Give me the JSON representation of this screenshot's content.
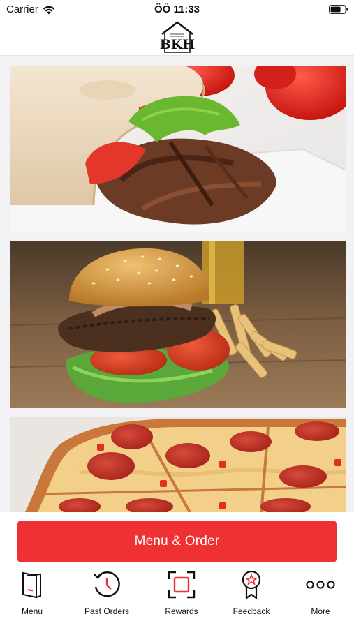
{
  "status_bar": {
    "carrier": "Carrier",
    "time": "ÖÖ 11:33",
    "wifi_icon": "wifi-icon",
    "battery_icon": "battery-icon"
  },
  "header": {
    "logo_text": "BKH"
  },
  "food_cards": [
    {
      "name": "doner-wrap-image"
    },
    {
      "name": "burger-image"
    },
    {
      "name": "pizza-image"
    }
  ],
  "cta": {
    "label": "Menu & Order",
    "color": "#ef3133"
  },
  "tab_bar": {
    "items": [
      {
        "label": "Menu",
        "icon": "menu-book-icon"
      },
      {
        "label": "Past Orders",
        "icon": "history-clock-icon"
      },
      {
        "label": "Rewards",
        "icon": "rewards-frame-icon"
      },
      {
        "label": "Feedback",
        "icon": "award-ribbon-icon"
      },
      {
        "label": "More",
        "icon": "more-dots-icon"
      }
    ],
    "accent_color": "#ef3133"
  }
}
